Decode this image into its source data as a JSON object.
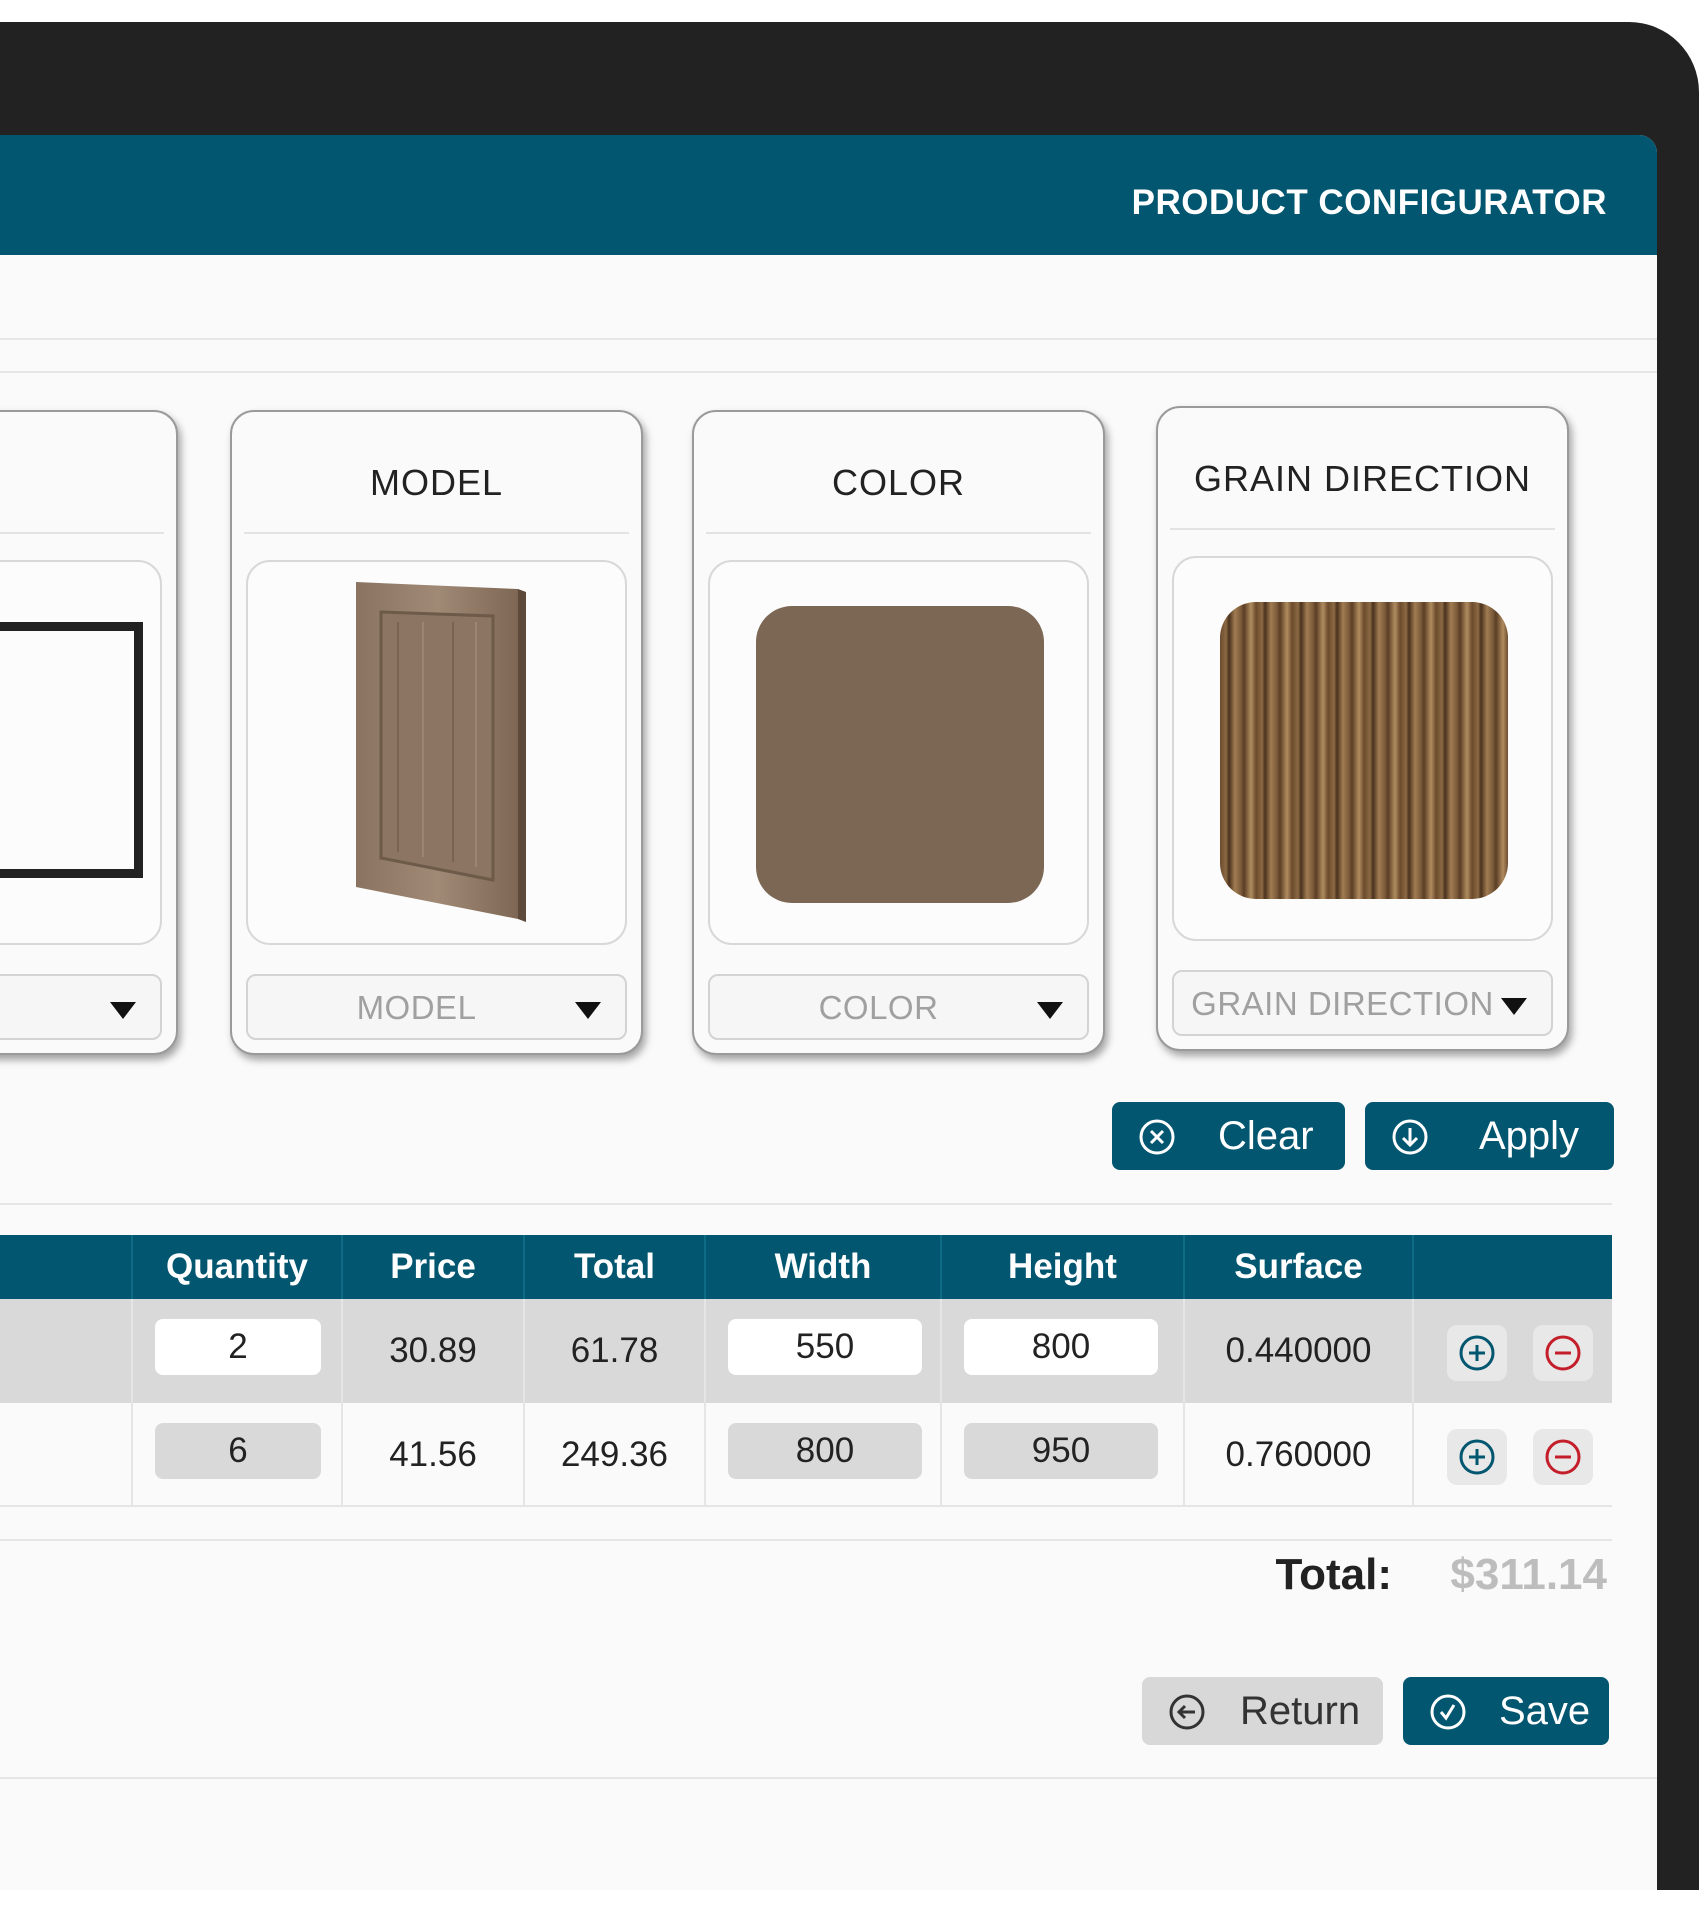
{
  "header": {
    "title": "PRODUCT CONFIGURATOR"
  },
  "colors": {
    "brand": "#035670",
    "swatch": "#7b6754",
    "minus_icon": "#c41e2a"
  },
  "cards": [
    {
      "title": "",
      "dropdown_label": ""
    },
    {
      "title": "MODEL",
      "dropdown_label": "MODEL",
      "icon": "cabinet-door-image"
    },
    {
      "title": "COLOR",
      "dropdown_label": "COLOR",
      "icon": "color-swatch"
    },
    {
      "title": "GRAIN DIRECTION",
      "dropdown_label": "GRAIN DIRECTION",
      "icon": "wood-grain-image"
    }
  ],
  "actions": {
    "clear_label": "Clear",
    "apply_label": "Apply"
  },
  "table": {
    "columns": [
      "Quantity",
      "Price",
      "Total",
      "Width",
      "Height",
      "Surface"
    ],
    "rows": [
      {
        "quantity": "2",
        "price": "30.89",
        "total": "61.78",
        "width": "550",
        "height": "800",
        "surface": "0.440000"
      },
      {
        "quantity": "6",
        "price": "41.56",
        "total": "249.36",
        "width": "800",
        "height": "950",
        "surface": "0.760000"
      }
    ]
  },
  "summary": {
    "total_label": "Total:",
    "total_value": "$311.14"
  },
  "footer": {
    "return_label": "Return",
    "save_label": "Save"
  }
}
